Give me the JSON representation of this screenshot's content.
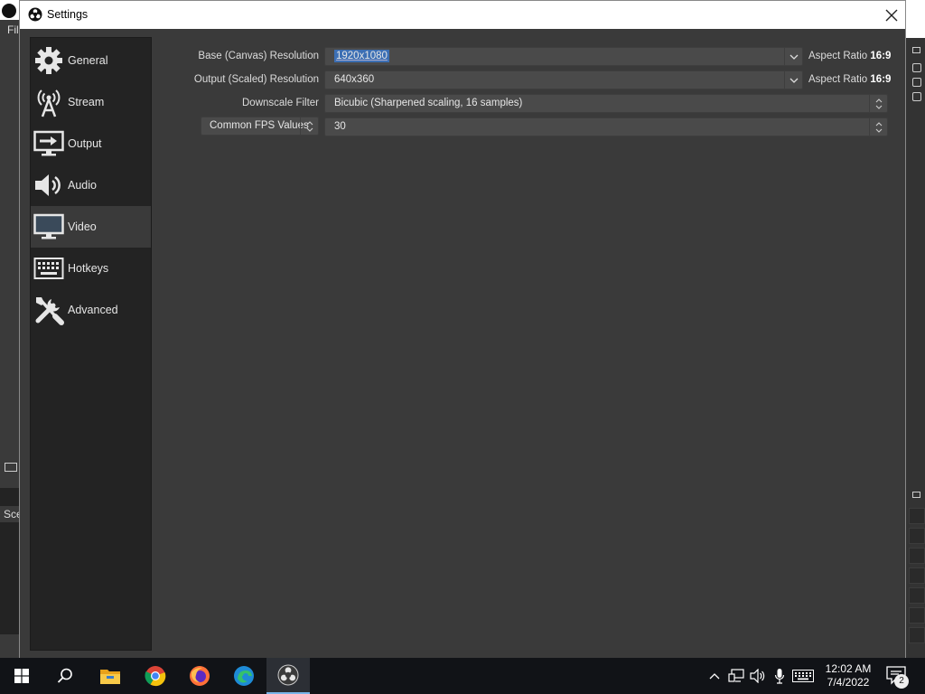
{
  "background": {
    "menu_label": "Fil",
    "scenes_label": "Sce"
  },
  "dialog": {
    "title": "Settings",
    "close_icon": "close-icon"
  },
  "sidebar": {
    "items": [
      {
        "label": "General",
        "icon": "gear-icon",
        "active": false
      },
      {
        "label": "Stream",
        "icon": "antenna-icon",
        "active": false
      },
      {
        "label": "Output",
        "icon": "output-icon",
        "active": false
      },
      {
        "label": "Audio",
        "icon": "speaker-icon",
        "active": false
      },
      {
        "label": "Video",
        "icon": "monitor-icon",
        "active": true
      },
      {
        "label": "Hotkeys",
        "icon": "keyboard-icon",
        "active": false
      },
      {
        "label": "Advanced",
        "icon": "wrench-screwdriver-icon",
        "active": false
      }
    ]
  },
  "video": {
    "base_resolution": {
      "label": "Base (Canvas) Resolution",
      "value": "1920x1080",
      "aspect_label": "Aspect Ratio",
      "aspect_value": "16:9"
    },
    "output_resolution": {
      "label": "Output (Scaled) Resolution",
      "value": "640x360",
      "aspect_label": "Aspect Ratio",
      "aspect_value": "16:9"
    },
    "downscale_filter": {
      "label": "Downscale Filter",
      "value": "Bicubic (Sharpened scaling, 16 samples)"
    },
    "fps": {
      "type_label": "Common FPS Values",
      "value": "30"
    }
  },
  "taskbar": {
    "apps": [
      "windows-start-icon",
      "search-icon",
      "file-explorer-icon",
      "chrome-icon",
      "firefox-icon",
      "edge-icon",
      "obs-icon"
    ],
    "active_app": "obs-icon",
    "time": "12:02 AM",
    "date": "7/4/2022",
    "notification_count": "2"
  },
  "colors": {
    "sidebar_bg": "#232323",
    "content_bg": "#3a3a3a",
    "field_bg": "#4a4a4a",
    "selection": "#3c6fb4",
    "taskbar_bg": "#111317"
  }
}
